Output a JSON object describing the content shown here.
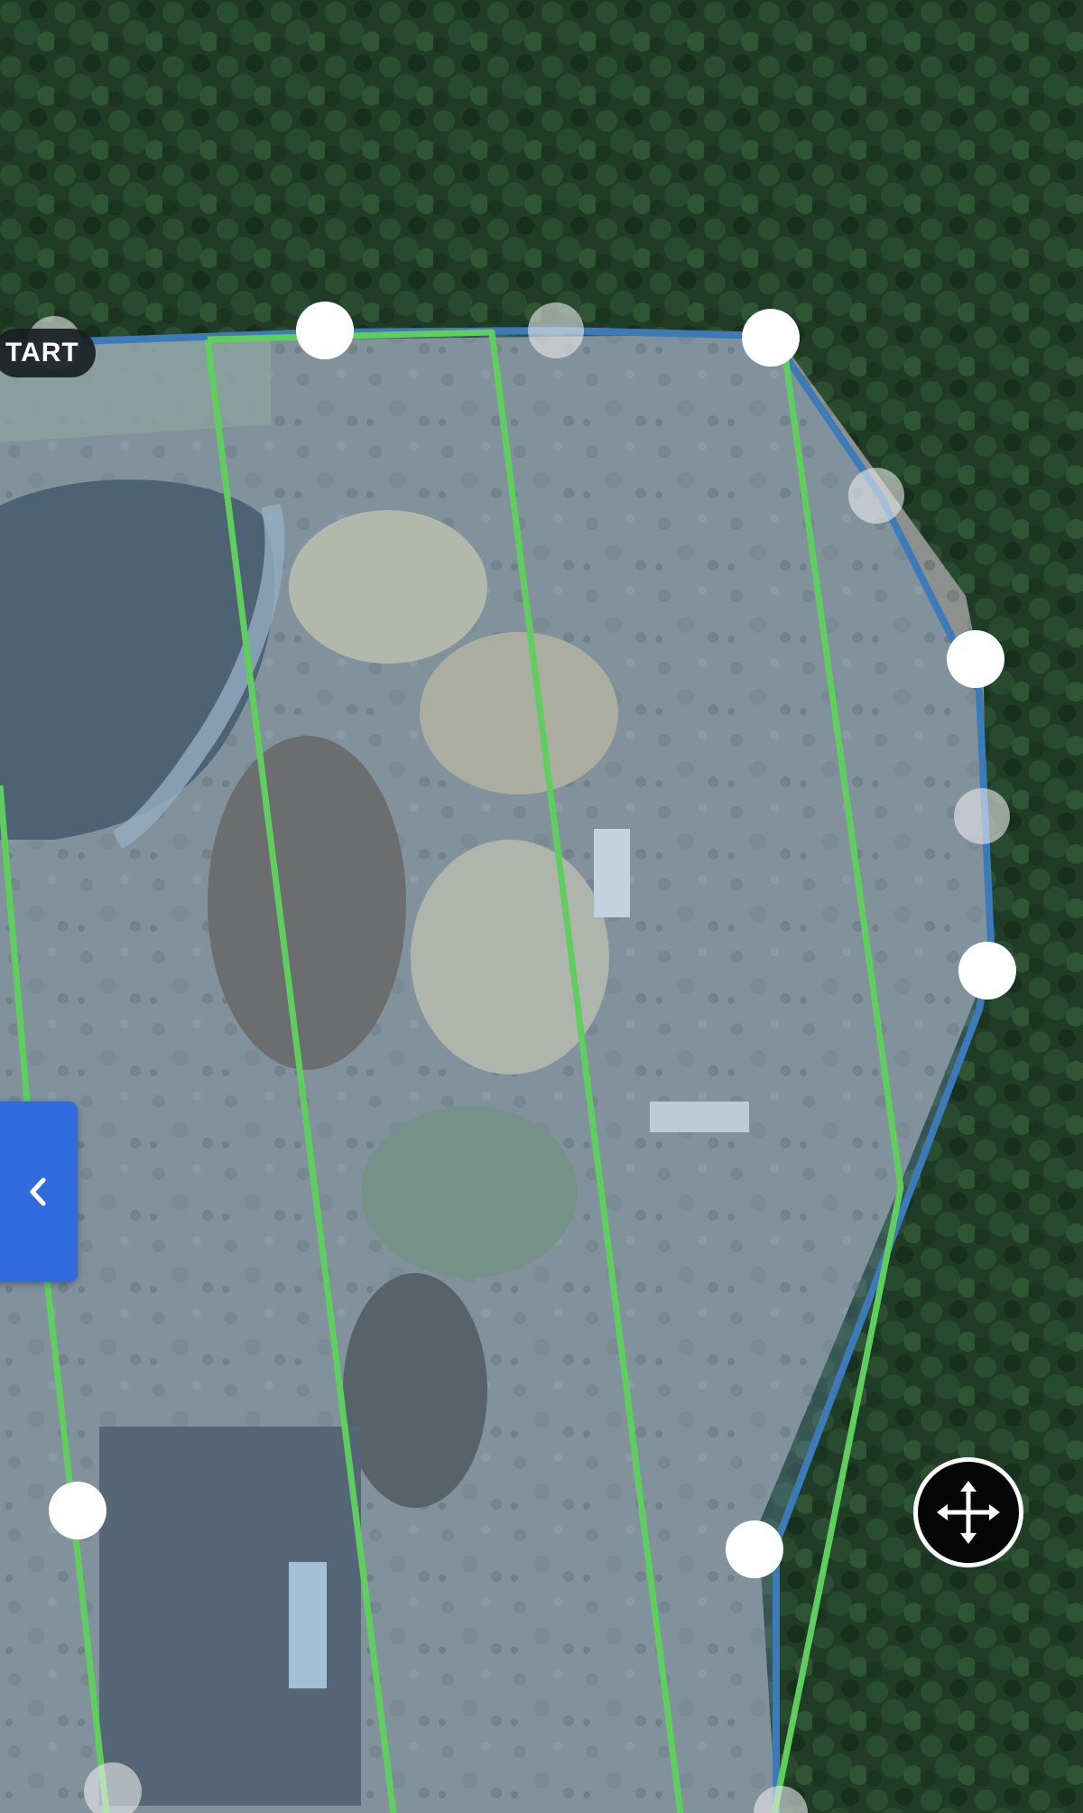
{
  "map": {
    "forest_color": "#1f3a24",
    "site_color": "#8a8f8c",
    "boundary_color": "#3d7ab8",
    "boundary_fill": "rgba(110,150,190,0.32)",
    "flight_line_color": "#5fce5f",
    "handle_color": "#ffffff",
    "midpoint_handle_color": "rgba(235,235,235,0.6)"
  },
  "start_badge": {
    "label": "TART"
  },
  "collapse_tab": {
    "icon": "chevron-left-icon",
    "color": "#2f6bdc"
  },
  "move_button": {
    "icon": "move-arrows-icon"
  }
}
